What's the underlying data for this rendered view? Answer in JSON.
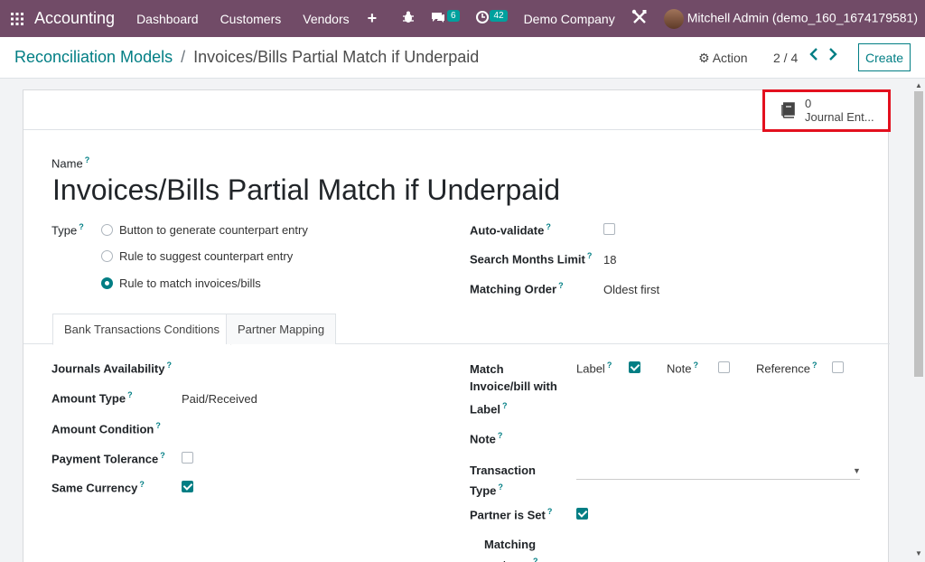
{
  "topbar": {
    "app_name": "Accounting",
    "menu": [
      "Dashboard",
      "Customers",
      "Vendors"
    ],
    "plus": "+",
    "messages_count": "6",
    "activities_count": "42",
    "company": "Demo Company",
    "user": "Mitchell Admin (demo_160_1674179581)",
    "bar_color": "#714b67"
  },
  "control": {
    "breadcrumb_parent": "Reconciliation Models",
    "breadcrumb_sep": "/",
    "breadcrumb_current": "Invoices/Bills Partial Match if Underpaid",
    "action_label": "Action",
    "pager": "2 / 4",
    "create_label": "Create"
  },
  "smart_button": {
    "count": "0",
    "label": "Journal Ent..."
  },
  "form": {
    "name_label": "Name",
    "name_value": "Invoices/Bills Partial Match if Underpaid",
    "type_label": "Type",
    "type_options": [
      {
        "label": "Button to generate counterpart entry",
        "selected": false
      },
      {
        "label": "Rule to suggest counterpart entry",
        "selected": false
      },
      {
        "label": "Rule to match invoices/bills",
        "selected": true
      }
    ],
    "auto_validate_label": "Auto-validate",
    "auto_validate": false,
    "search_months_label": "Search Months Limit",
    "search_months_value": "18",
    "matching_order_label": "Matching Order",
    "matching_order_value": "Oldest first",
    "help_mark": "?"
  },
  "tabs": [
    {
      "label": "Bank Transactions Conditions",
      "active": true
    },
    {
      "label": "Partner Mapping",
      "active": false
    }
  ],
  "conditions": {
    "journals_label": "Journals Availability",
    "amount_type_label": "Amount Type",
    "amount_type_value": "Paid/Received",
    "amount_condition_label": "Amount Condition",
    "payment_tolerance_label": "Payment Tolerance",
    "payment_tolerance": false,
    "same_currency_label": "Same Currency",
    "same_currency": true,
    "match_label_line1": "Match",
    "match_label_line2": "Invoice/bill with",
    "match_opt_label": "Label",
    "match_opt_label_checked": true,
    "match_opt_note": "Note",
    "match_opt_note_checked": false,
    "match_opt_reference": "Reference",
    "match_opt_reference_checked": false,
    "label_label": "Label",
    "note_label": "Note",
    "transaction_type_line1": "Transaction",
    "transaction_type_line2": "Type",
    "partner_set_label": "Partner is Set",
    "partner_set": true,
    "matching_partners_line1": "Matching",
    "matching_partners_line2": "partners"
  }
}
